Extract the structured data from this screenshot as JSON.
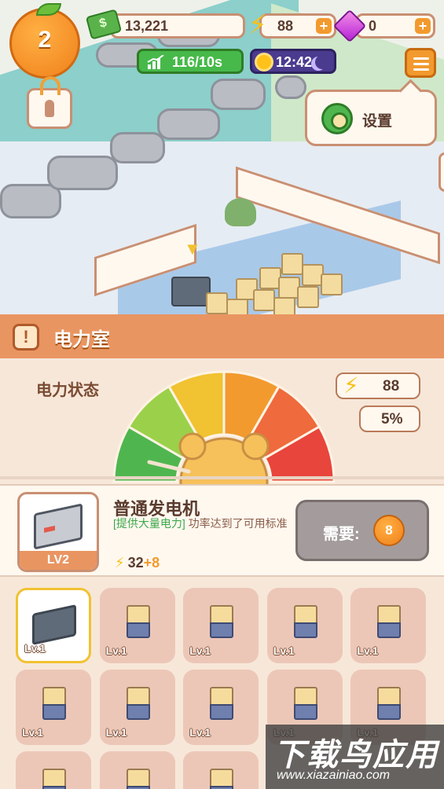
{
  "hud": {
    "level": "2",
    "cash": "13,221",
    "power": "88",
    "gems": "0",
    "rate": "116/10s",
    "time": "12:42"
  },
  "settings_popup": {
    "label": "设置"
  },
  "panel": {
    "title": "电力室",
    "status_label": "电力状态",
    "power_value": "88",
    "power_percent": "5%"
  },
  "generator": {
    "name": "普通发电机",
    "desc_tag": "[提供大量电力]",
    "desc_text": " 功率达到了可用标准",
    "level": "LV2",
    "power_base": "32",
    "power_inc": "+8",
    "need_label": "需要:",
    "need_amount": "8"
  },
  "grid": {
    "items": [
      {
        "lv": "Lv.1",
        "kind": "generator",
        "selected": true
      },
      {
        "lv": "Lv.1",
        "kind": "battery"
      },
      {
        "lv": "Lv.1",
        "kind": "battery"
      },
      {
        "lv": "Lv.1",
        "kind": "battery"
      },
      {
        "lv": "Lv.1",
        "kind": "battery"
      },
      {
        "lv": "Lv.1",
        "kind": "battery"
      },
      {
        "lv": "Lv.1",
        "kind": "battery"
      },
      {
        "lv": "Lv.1",
        "kind": "battery"
      },
      {
        "lv": "Lv.1",
        "kind": "battery"
      },
      {
        "lv": "Lv.1",
        "kind": "battery"
      }
    ]
  },
  "watermark": {
    "big": "下载鸟应用",
    "small": "www.xiazainiao.com"
  },
  "colors": {
    "accent": "#e99562",
    "gauge": [
      "#4fb64f",
      "#9bd14a",
      "#f1c231",
      "#f29a2e",
      "#ef6a3c",
      "#e8453c"
    ]
  }
}
